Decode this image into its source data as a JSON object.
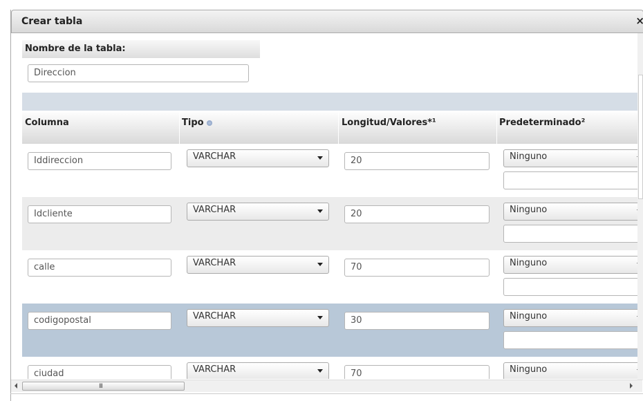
{
  "dialog": {
    "title": "Crear tabla",
    "close_glyph": "×"
  },
  "table_name": {
    "label": "Nombre de la tabla:",
    "value": "Direccion"
  },
  "columns_header": {
    "columna": "Columna",
    "tipo": "Tipo",
    "longitud": "Longitud/Valores*¹",
    "predeterminado": "Predeterminado²"
  },
  "rows": [
    {
      "name": "Iddireccion",
      "type": "VARCHAR",
      "length": "20",
      "default": "Ninguno"
    },
    {
      "name": "Idcliente",
      "type": "VARCHAR",
      "length": "20",
      "default": "Ninguno"
    },
    {
      "name": "calle",
      "type": "VARCHAR",
      "length": "70",
      "default": "Ninguno"
    },
    {
      "name": "codigopostal",
      "type": "VARCHAR",
      "length": "30",
      "default": "Ninguno"
    },
    {
      "name": "ciudad",
      "type": "VARCHAR",
      "length": "70",
      "default": "Ninguno"
    }
  ],
  "scrollbar": {
    "grip": "III"
  },
  "colors": {
    "band": "#d5dde6",
    "row_highlight": "#b8c8d8",
    "row_alt": "#ececec"
  }
}
